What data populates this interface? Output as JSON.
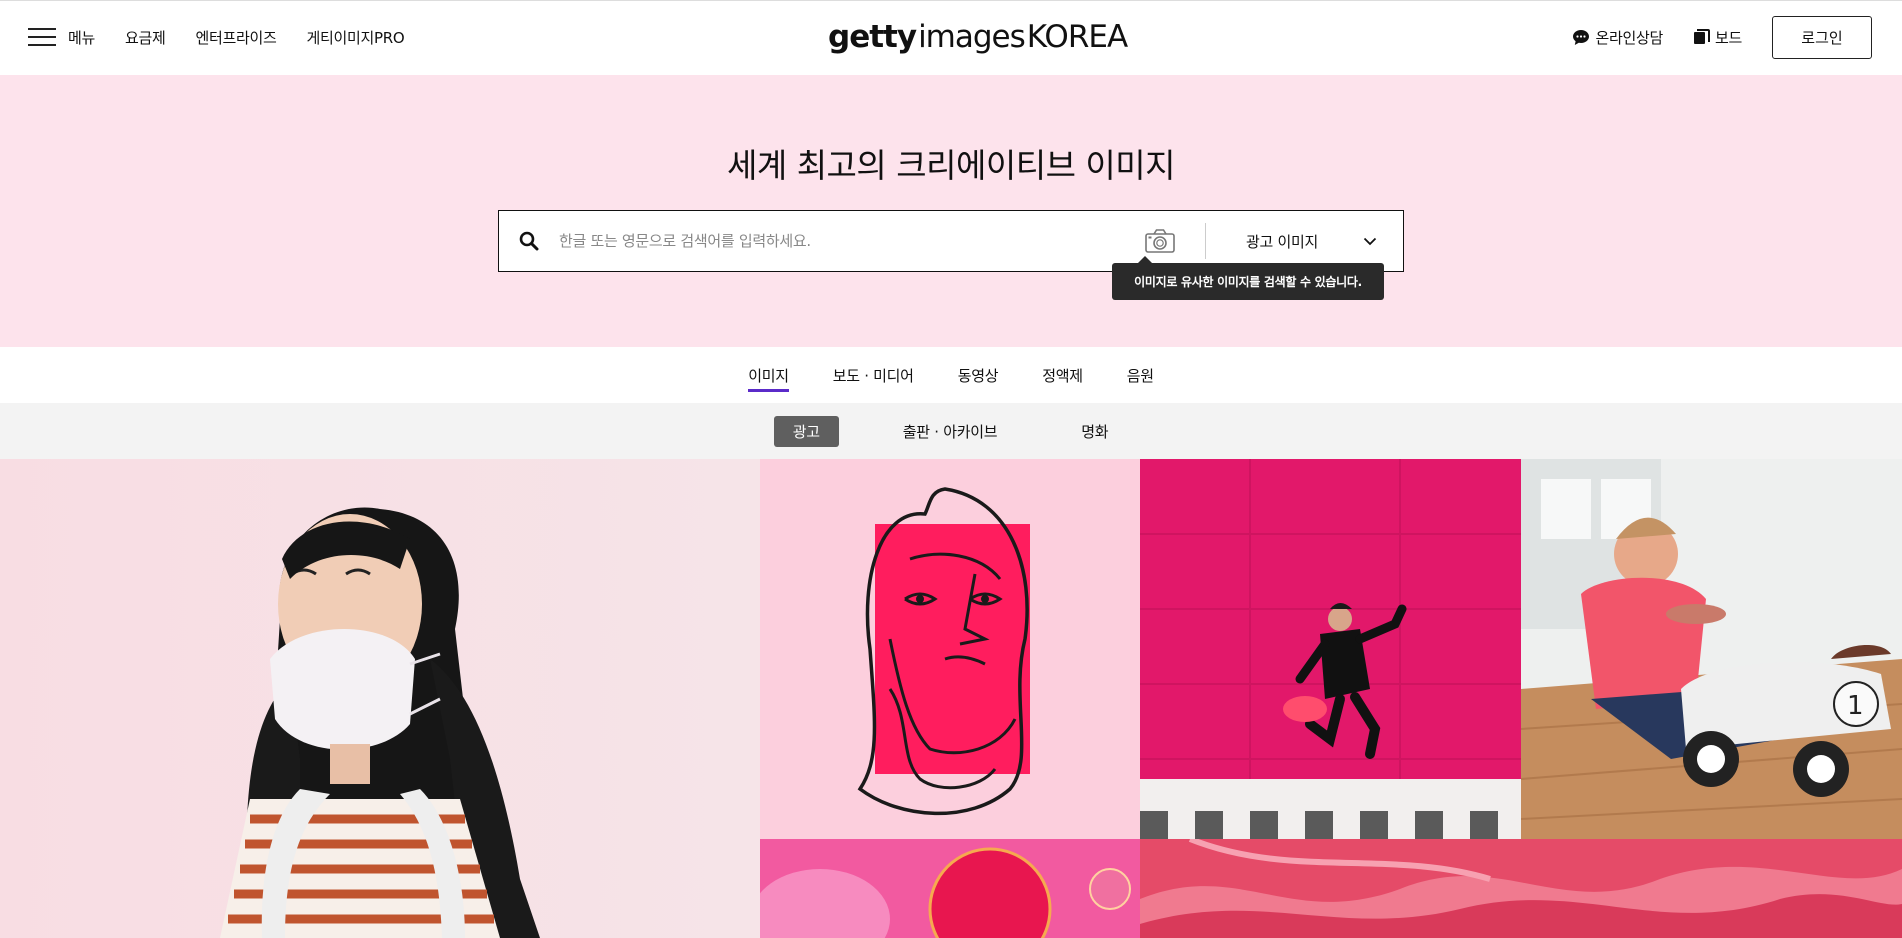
{
  "header": {
    "menu_label": "메뉴",
    "nav": [
      "요금제",
      "엔터프라이즈",
      "게티이미지PRO"
    ],
    "logo": {
      "bold": "getty",
      "light": "images",
      "suffix": "KOREA"
    },
    "chat_label": "온라인상담",
    "board_label": "보드",
    "login_label": "로그인"
  },
  "hero": {
    "title": "세계 최고의 크리에이티브 이미지",
    "search_placeholder": "한글 또는 영문으로 검색어를 입력하세요.",
    "type_selected": "광고 이미지",
    "tooltip": "이미지로 유사한 이미지를 검색할 수 있습니다."
  },
  "tabs": {
    "main": [
      "이미지",
      "보도 · 미디어",
      "동영상",
      "정액제",
      "음원"
    ],
    "main_active": "이미지",
    "sub": [
      "광고",
      "출판 · 아카이브",
      "명화"
    ],
    "sub_active": "광고"
  },
  "colors": {
    "hero_bg": "#fde3ec",
    "active_tab_underline": "#5b2bc9",
    "subtab_active_bg": "#5f5f5f",
    "accent_pink": "#ff1d5e"
  },
  "icons": [
    "hamburger-icon",
    "chat-bubble-icon",
    "board-icon",
    "search-icon",
    "camera-icon",
    "chevron-down-icon"
  ]
}
